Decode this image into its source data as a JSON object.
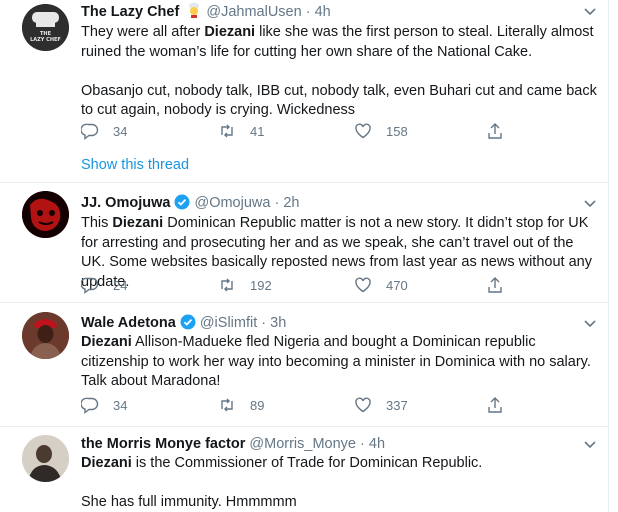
{
  "tweets": [
    {
      "name": "The Lazy Chef",
      "handle": "@JahmalUsen",
      "time": "4h",
      "emoji": "chef-emoji",
      "verified": false,
      "avatar_text": "THE LAZY CHEF",
      "text1_bold": "",
      "text1a": "They were all after ",
      "text1_kw": "Diezani",
      "text1b": " like she was the first person to steal. Literally almost ruined the woman’s life for cutting her own share of the National Cake.",
      "text2": "Obasanjo cut, nobody talk, IBB cut, nobody talk, even Buhari cut and came back to cut again, nobody is crying. Wickedness",
      "replies": "34",
      "retweets": "41",
      "likes": "158",
      "show_thread": "Show this thread"
    },
    {
      "name": "JJ. Omojuwa",
      "handle": "@Omojuwa",
      "time": "2h",
      "verified": true,
      "text1a": "This ",
      "text1_kw": "Diezani",
      "text1b": " Dominican Republic matter is not a new story. It didn’t stop for UK for arresting and prosecuting her and as we speak, she can’t travel out of the UK. Some websites basically reposted news from last year as news without any update.",
      "replies": "24",
      "retweets": "192",
      "likes": "470"
    },
    {
      "name": "Wale Adetona",
      "handle": "@iSlimfit",
      "time": "3h",
      "verified": true,
      "text1_kw": "Diezani",
      "text1b": " Allison-Madueke fled Nigeria and bought a Dominican republic citizenship to work her way into becoming a minister in Dominica with no salary. Talk about Maradona!",
      "replies": "34",
      "retweets": "89",
      "likes": "337"
    },
    {
      "name": "the Morris Monye factor",
      "handle": "@Morris_Monye",
      "time": "4h",
      "verified": false,
      "text1_kw": "Diezani",
      "text1b": " is the Commissioner of Trade for Dominican Republic.",
      "text2": "She has full immunity. Hmmmmm"
    }
  ],
  "separator": "·",
  "colors": {
    "link": "#1b95e0",
    "verified": "#1da1f2",
    "secondary": "#657786",
    "border": "#e6ecf0"
  }
}
